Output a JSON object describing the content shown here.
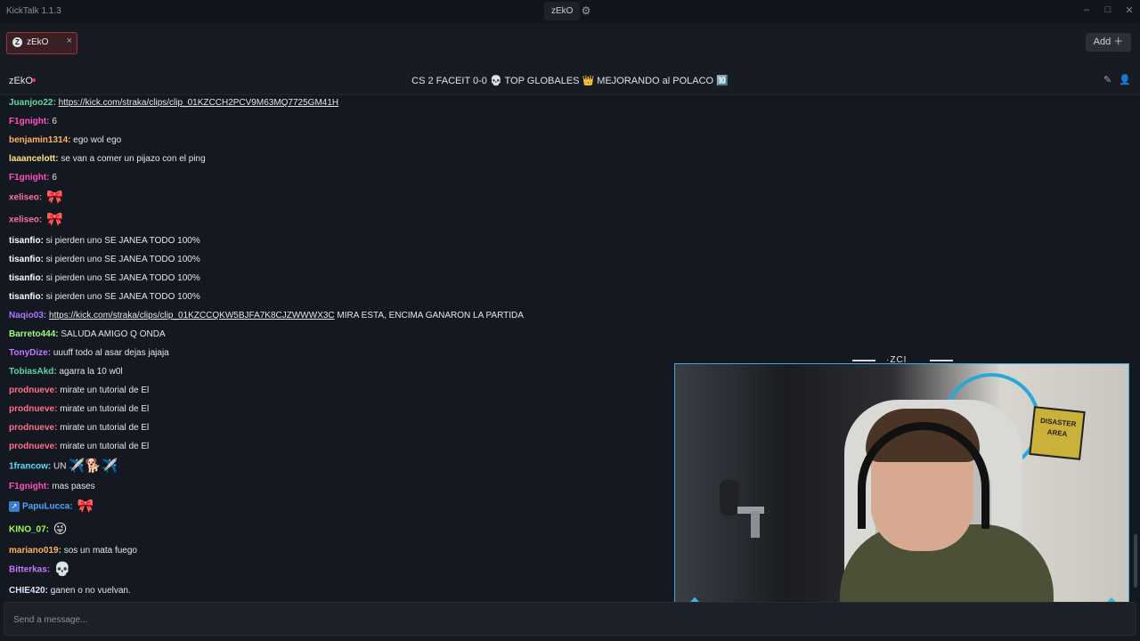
{
  "app": {
    "title": "KickTalk 1.1.3",
    "channel_chip": "zEkO",
    "gear_icon": "gear-icon"
  },
  "window_controls": {
    "minimize": "–",
    "maximize": "□",
    "close": "✕"
  },
  "tabs": [
    {
      "label": "zEkO",
      "avatar": "Z",
      "close": "×"
    }
  ],
  "add_button": "Add ＋",
  "header": {
    "streamer": "zEkO",
    "title": "CS 2 FACEIT 0-0 💀 TOP GLOBALES 👑 MEJORANDO al POLACO 🔟"
  },
  "messages": [
    {
      "user": "Juanjoo22:",
      "color": "#62d9a4",
      "link": "https://kick.com/straka/clips/clip_01KZCCH2PCV9M63MQ7725GM41H",
      "text": ""
    },
    {
      "user": "F1gnight:",
      "color": "#ff4fc0",
      "text": "6"
    },
    {
      "user": "benjamin1314:",
      "color": "#ffb35c",
      "text": "ego wol ego"
    },
    {
      "user": "laaancelott:",
      "color": "#ffe27a",
      "text": "se van a comer un pijazo con el ping"
    },
    {
      "user": "F1gnight:",
      "color": "#ff4fc0",
      "text": "6"
    },
    {
      "user": "xeliseo:",
      "color": "#ff6fa8",
      "text": "",
      "emote": "🎀"
    },
    {
      "user": "xeliseo:",
      "color": "#ff6fa8",
      "text": "",
      "emote": "🎀"
    },
    {
      "user": "tisanfio:",
      "color": "#ffffff",
      "text": "si pierden uno SE JANEA TODO 100%"
    },
    {
      "user": "tisanfio:",
      "color": "#ffffff",
      "text": "si pierden uno SE JANEA TODO 100%"
    },
    {
      "user": "tisanfio:",
      "color": "#ffffff",
      "text": "si pierden uno SE JANEA TODO 100%"
    },
    {
      "user": "tisanfio:",
      "color": "#ffffff",
      "text": "si pierden uno SE JANEA TODO 100%"
    },
    {
      "user": "Naqio03:",
      "color": "#b072ff",
      "link": "https://kick.com/straka/clips/clip_01KZCCQKW5BJFA7K8CJZWWWX3C",
      "text": "MIRA ESTA, ENCIMA GANARON LA PARTIDA"
    },
    {
      "user": "Barreto444:",
      "color": "#9cff7a",
      "text": "SALUDA AMIGO Q ONDA"
    },
    {
      "user": "TonyDize:",
      "color": "#c778ff",
      "text": "uuuff todo al asar dejas jajaja"
    },
    {
      "user": "TobiasAkd:",
      "color": "#5cd6a6",
      "text": "agarra la 10 w0l"
    },
    {
      "user": "prodnueve:",
      "color": "#ff6f8a",
      "text": "mirate un tutorial de El"
    },
    {
      "user": "prodnueve:",
      "color": "#ff6f8a",
      "text": "mirate un tutorial de El"
    },
    {
      "user": "prodnueve:",
      "color": "#ff6f8a",
      "text": "mirate un tutorial de El"
    },
    {
      "user": "prodnueve:",
      "color": "#ff6f8a",
      "text": "mirate un tutorial de El"
    },
    {
      "user": "1francow:",
      "color": "#4fe3ff",
      "text": "UN",
      "emote": "✈️🐕✈️"
    },
    {
      "user": "F1gnight:",
      "color": "#ff4fc0",
      "text": "mas pases"
    },
    {
      "user": "PapuLucca:",
      "color": "#4fa7ff",
      "text": "",
      "emote": "🎀",
      "badge": true
    },
    {
      "user": "KINO_07:",
      "color": "#9cff4f",
      "text": "",
      "emote": "😜"
    },
    {
      "user": "mariano019:",
      "color": "#ffb35c",
      "text": "sos un mata fuego"
    },
    {
      "user": "Bitterkas:",
      "color": "#c778ff",
      "text": "",
      "emote": "💀"
    },
    {
      "user": "CHIE420:",
      "color": "#d8e4ff",
      "text": "ganen o no vuelvan."
    }
  ],
  "input": {
    "placeholder": "Send a message..."
  },
  "webcam": {
    "overlay_label": "·ZCI",
    "logo": "Z",
    "sign": "DISASTER AREA"
  }
}
